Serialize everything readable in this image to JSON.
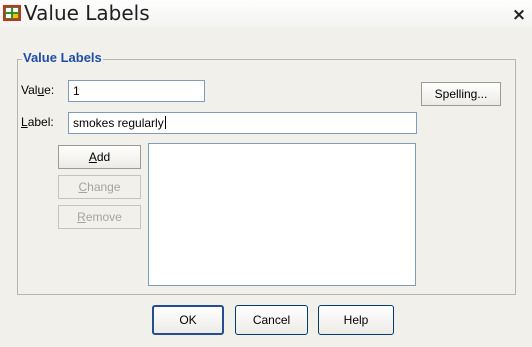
{
  "window": {
    "title": "Value Labels",
    "close_glyph": "×",
    "icon": "spss-dialog-icon"
  },
  "group": {
    "label": "Value Labels"
  },
  "value_field": {
    "label_before": "Val",
    "label_mnemonic": "u",
    "label_after": "e:",
    "value": "1"
  },
  "label_field": {
    "label_before": "",
    "label_mnemonic": "L",
    "label_after": "abel:",
    "value": "smokes regularly"
  },
  "side_buttons": {
    "add": {
      "mnemonic": "A",
      "rest": "dd",
      "enabled": true
    },
    "change": {
      "mnemonic": "C",
      "rest": "hange",
      "enabled": false
    },
    "remove": {
      "mnemonic": "R",
      "rest": "emove",
      "enabled": false
    }
  },
  "spelling_button": {
    "label": "Spelling..."
  },
  "footer": {
    "ok": "OK",
    "cancel": "Cancel",
    "help": "Help"
  },
  "value_list": {
    "items": []
  },
  "colors": {
    "group_label": "#1e4ea5",
    "dialog_bg": "#f1f0eb",
    "field_border": "#7f9db9",
    "button_border": "#003c74"
  }
}
